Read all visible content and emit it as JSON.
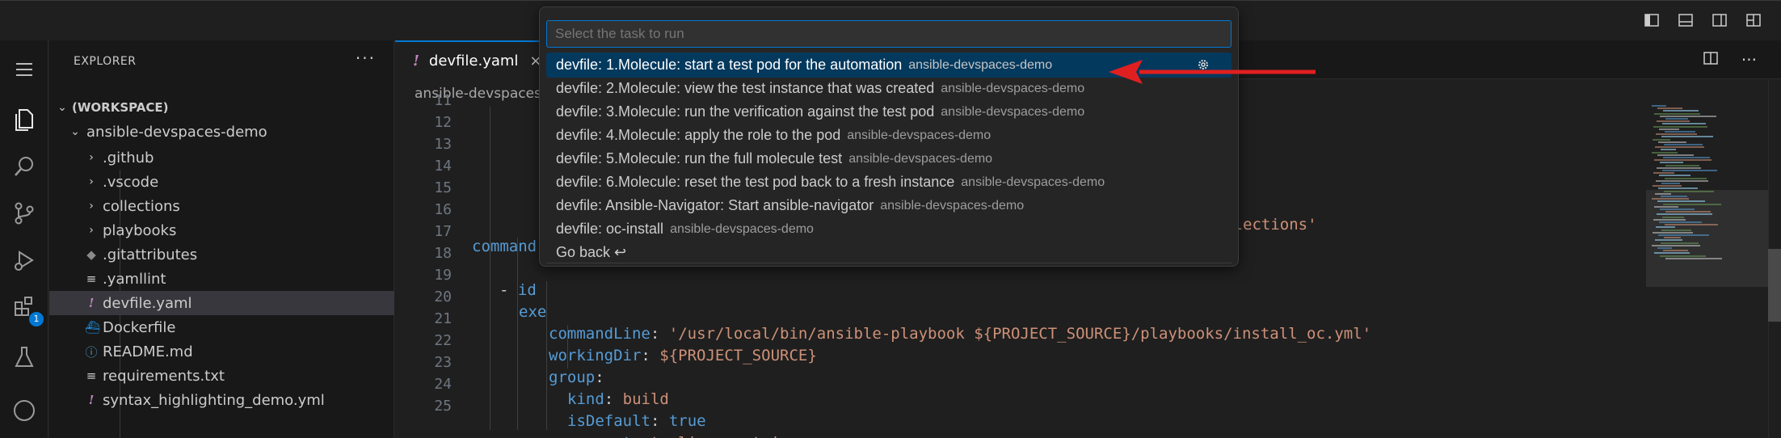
{
  "explorer": {
    "header": "EXPLORER",
    "more": "···",
    "workspace": "(WORKSPACE)",
    "folder": "ansible-devspaces-demo",
    "items": [
      {
        "label": ".github",
        "kind": "folder"
      },
      {
        "label": ".vscode",
        "kind": "folder"
      },
      {
        "label": "collections",
        "kind": "folder"
      },
      {
        "label": "playbooks",
        "kind": "folder"
      },
      {
        "label": ".gitattributes",
        "kind": "file",
        "icon": "diamond-icon"
      },
      {
        "label": ".yamllint",
        "kind": "file",
        "icon": "lines-icon"
      },
      {
        "label": "devfile.yaml",
        "kind": "file",
        "icon": "exclamation-icon",
        "selected": true
      },
      {
        "label": "Dockerfile",
        "kind": "file",
        "icon": "docker-icon"
      },
      {
        "label": "README.md",
        "kind": "file",
        "icon": "info-icon"
      },
      {
        "label": "requirements.txt",
        "kind": "file",
        "icon": "lines-icon"
      },
      {
        "label": "syntax_highlighting_demo.yml",
        "kind": "file",
        "icon": "exclamation-icon"
      }
    ]
  },
  "activity": {
    "extensions_badge": "1"
  },
  "editor": {
    "tab_label": "devfile.yaml",
    "tab_prefix": "!",
    "tab_close": "×",
    "breadcrumb": "ansible-devspaces",
    "line_numbers": [
      "11",
      "12",
      "13",
      "14",
      "15",
      "16",
      "17",
      "18",
      "19",
      "20",
      "21",
      "22",
      "23",
      "24",
      "25"
    ],
    "code": {
      "l15_tail": "ects/ansible-devspaces-demo/collections'",
      "l16": "command",
      "l18_dash": "- ",
      "l18_key": "id",
      "l19_key": "exe",
      "l20_key": "commandLine",
      "l20_val": "'/usr/local/bin/ansible-playbook ${PROJECT_SOURCE}/playbooks/install_oc.yml'",
      "l21_key": "workingDir",
      "l21_val": "${PROJECT_SOURCE}",
      "l22_key": "group",
      "l23_key": "kind",
      "l23_val": "build",
      "l24_key": "isDefault",
      "l24_val": "true",
      "l25_key": "component",
      "l25_val": "tooling-container",
      "colon": ":"
    }
  },
  "palette": {
    "placeholder": "Select the task to run",
    "items": [
      {
        "label": "devfile: 1.Molecule: start a test pod for the automation",
        "desc": "ansible-devspaces-demo",
        "active": true
      },
      {
        "label": "devfile: 2.Molecule: view the test instance that was created",
        "desc": "ansible-devspaces-demo"
      },
      {
        "label": "devfile: 3.Molecule: run the verification against the test pod",
        "desc": "ansible-devspaces-demo"
      },
      {
        "label": "devfile: 4.Molecule: apply the role to the pod",
        "desc": "ansible-devspaces-demo"
      },
      {
        "label": "devfile: 5.Molecule: run the full molecule test",
        "desc": "ansible-devspaces-demo"
      },
      {
        "label": "devfile: 6.Molecule: reset the test pod back to a fresh instance",
        "desc": "ansible-devspaces-demo"
      },
      {
        "label": "devfile: Ansible-Navigator: Start ansible-navigator",
        "desc": "ansible-devspaces-demo"
      },
      {
        "label": "devfile: oc-install",
        "desc": "ansible-devspaces-demo"
      },
      {
        "label": "Go back ↩",
        "desc": ""
      }
    ]
  },
  "colors": {
    "accent": "#0078d4",
    "arrow": "#e02020",
    "selection": "#04395e"
  }
}
